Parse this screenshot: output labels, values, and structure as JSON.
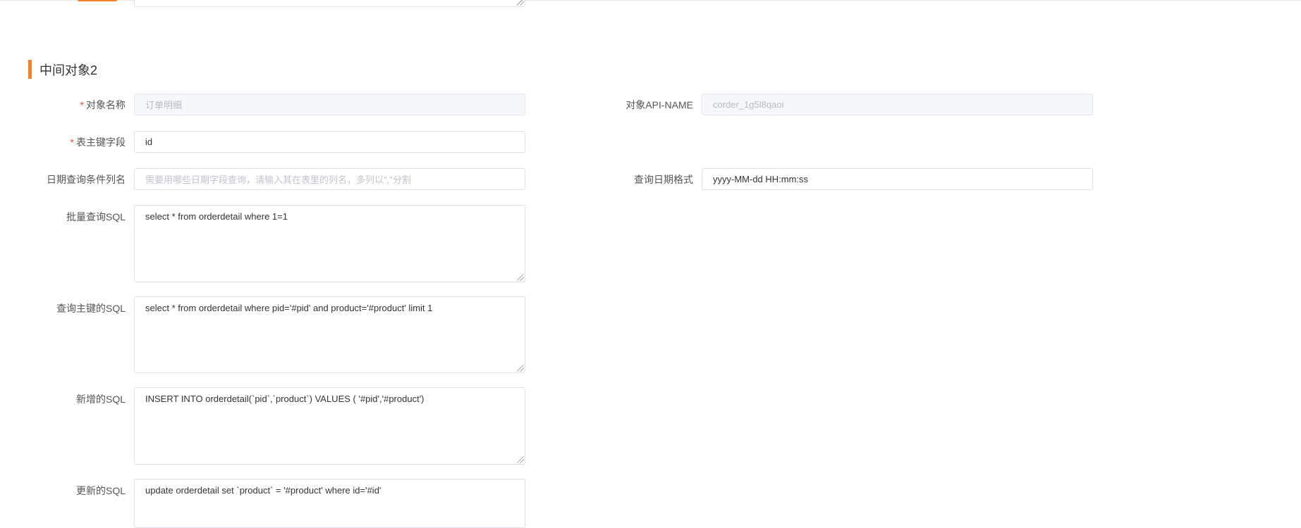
{
  "section": {
    "title": "中间对象2"
  },
  "form": {
    "object_name": {
      "label": "对象名称",
      "required_mark": "*",
      "value": "订单明细"
    },
    "api_name": {
      "label": "对象API-NAME",
      "value": "corder_1g5l8qaoi"
    },
    "primary_key": {
      "label": "表主键字段",
      "required_mark": "*",
      "value": "id"
    },
    "date_condition": {
      "label": "日期查询条件列名",
      "placeholder": "需要用哪些日期字段查询，请输入其在表里的列名，多列以\",\"分割"
    },
    "date_format": {
      "label": "查询日期格式",
      "value": "yyyy-MM-dd HH:mm:ss"
    },
    "batch_sql": {
      "label": "批量查询SQL",
      "value": "select * from orderdetail where 1=1"
    },
    "pk_sql": {
      "label": "查询主键的SQL",
      "value": "select * from orderdetail where pid='#pid' and product='#product' limit 1"
    },
    "insert_sql": {
      "label": "新增的SQL",
      "value": "INSERT INTO orderdetail(`pid`,`product`) VALUES ( '#pid','#product')"
    },
    "update_sql": {
      "label": "更新的SQL",
      "value": "update orderdetail set `product` = '#product' where id='#id'"
    }
  },
  "colors": {
    "accent": "#f5822a",
    "required": "#e84c3d",
    "border": "#dcdfe6",
    "disabled_bg": "#f5f7fa"
  }
}
